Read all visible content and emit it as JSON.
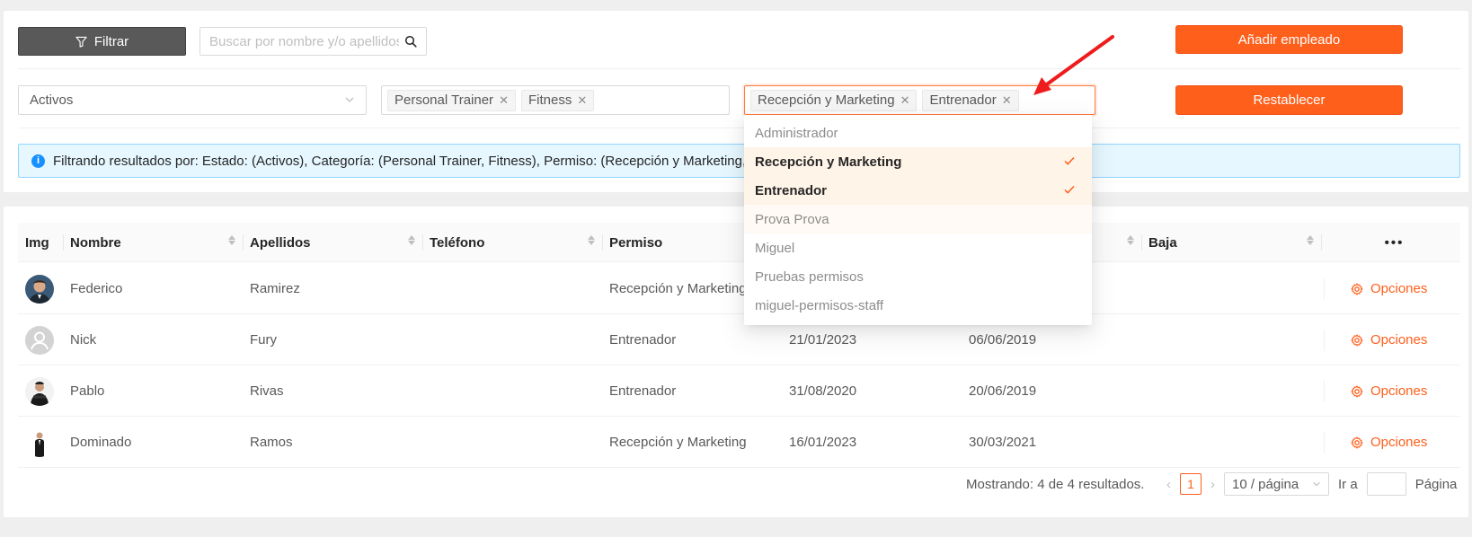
{
  "toolbar": {
    "filter_label": "Filtrar",
    "search_placeholder": "Buscar por nombre y/o apellidos",
    "add_label": "Añadir empleado",
    "reset_label": "Restablecer"
  },
  "filters": {
    "status_value": "Activos",
    "categories": [
      "Personal Trainer",
      "Fitness"
    ],
    "permissions": [
      "Recepción y Marketing",
      "Entrenador"
    ]
  },
  "alert": {
    "text": "Filtrando resultados por: Estado: (Activos), Categoría: (Personal Trainer, Fitness), Permiso: (Recepción y Marketing, Entrenador)"
  },
  "dropdown": {
    "options": [
      {
        "label": "Administrador",
        "selected": false
      },
      {
        "label": "Recepción y Marketing",
        "selected": true
      },
      {
        "label": "Entrenador",
        "selected": true
      },
      {
        "label": "Prova Prova",
        "selected": false
      },
      {
        "label": "Miguel",
        "selected": false
      },
      {
        "label": "Pruebas permisos",
        "selected": false
      },
      {
        "label": "miguel-permisos-staff",
        "selected": false
      }
    ]
  },
  "table": {
    "headers": {
      "img": "Img",
      "nombre": "Nombre",
      "apellidos": "Apellidos",
      "telefono": "Teléfono",
      "permiso": "Permiso",
      "alta": "",
      "antiguedad": "",
      "baja": "Baja",
      "more": "•••"
    },
    "rows": [
      {
        "nombre": "Federico",
        "apellidos": "Ramirez",
        "telefono": "",
        "permiso": "Recepción y Marketing",
        "fecha1": "",
        "fecha2": "",
        "baja": "",
        "opciones": "Opciones"
      },
      {
        "nombre": "Nick",
        "apellidos": "Fury",
        "telefono": "",
        "permiso": "Entrenador",
        "fecha1": "21/01/2023",
        "fecha2": "06/06/2019",
        "baja": "",
        "opciones": "Opciones"
      },
      {
        "nombre": "Pablo",
        "apellidos": "Rivas",
        "telefono": "",
        "permiso": "Entrenador",
        "fecha1": "31/08/2020",
        "fecha2": "20/06/2019",
        "baja": "",
        "opciones": "Opciones"
      },
      {
        "nombre": "Dominado",
        "apellidos": "Ramos",
        "telefono": "",
        "permiso": "Recepción y Marketing",
        "fecha1": "16/01/2023",
        "fecha2": "30/03/2021",
        "baja": "",
        "opciones": "Opciones"
      }
    ]
  },
  "pagination": {
    "summary": "Mostrando: 4 de 4 resultados.",
    "current_page": "1",
    "page_size": "10 / página",
    "goto_label": "Ir a",
    "page_label": "Página"
  },
  "colors": {
    "accent": "#fe5f1b",
    "info": "#1890ff"
  }
}
